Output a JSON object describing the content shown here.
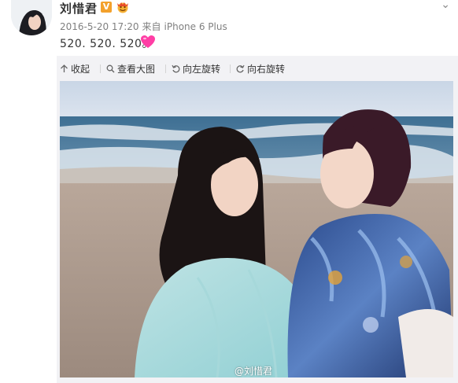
{
  "post": {
    "username": "刘惜君",
    "verified_mark": "V",
    "timestamp": "2016-5-20 17:20",
    "source_prefix": "来自",
    "source": "iPhone 6 Plus",
    "text": "520. 520. 520。",
    "emoji": "heart-emoji"
  },
  "toolbar": {
    "collapse_label": "收起",
    "view_large_label": "查看大图",
    "rotate_left_label": "向左旋转",
    "rotate_right_label": "向右旋转"
  },
  "image": {
    "watermark": "@刘惜君"
  },
  "colors": {
    "verified": "#f3a12c",
    "meta_text": "#808080",
    "heart": "#ff3ea5",
    "media_background": "#f2f2f5"
  }
}
